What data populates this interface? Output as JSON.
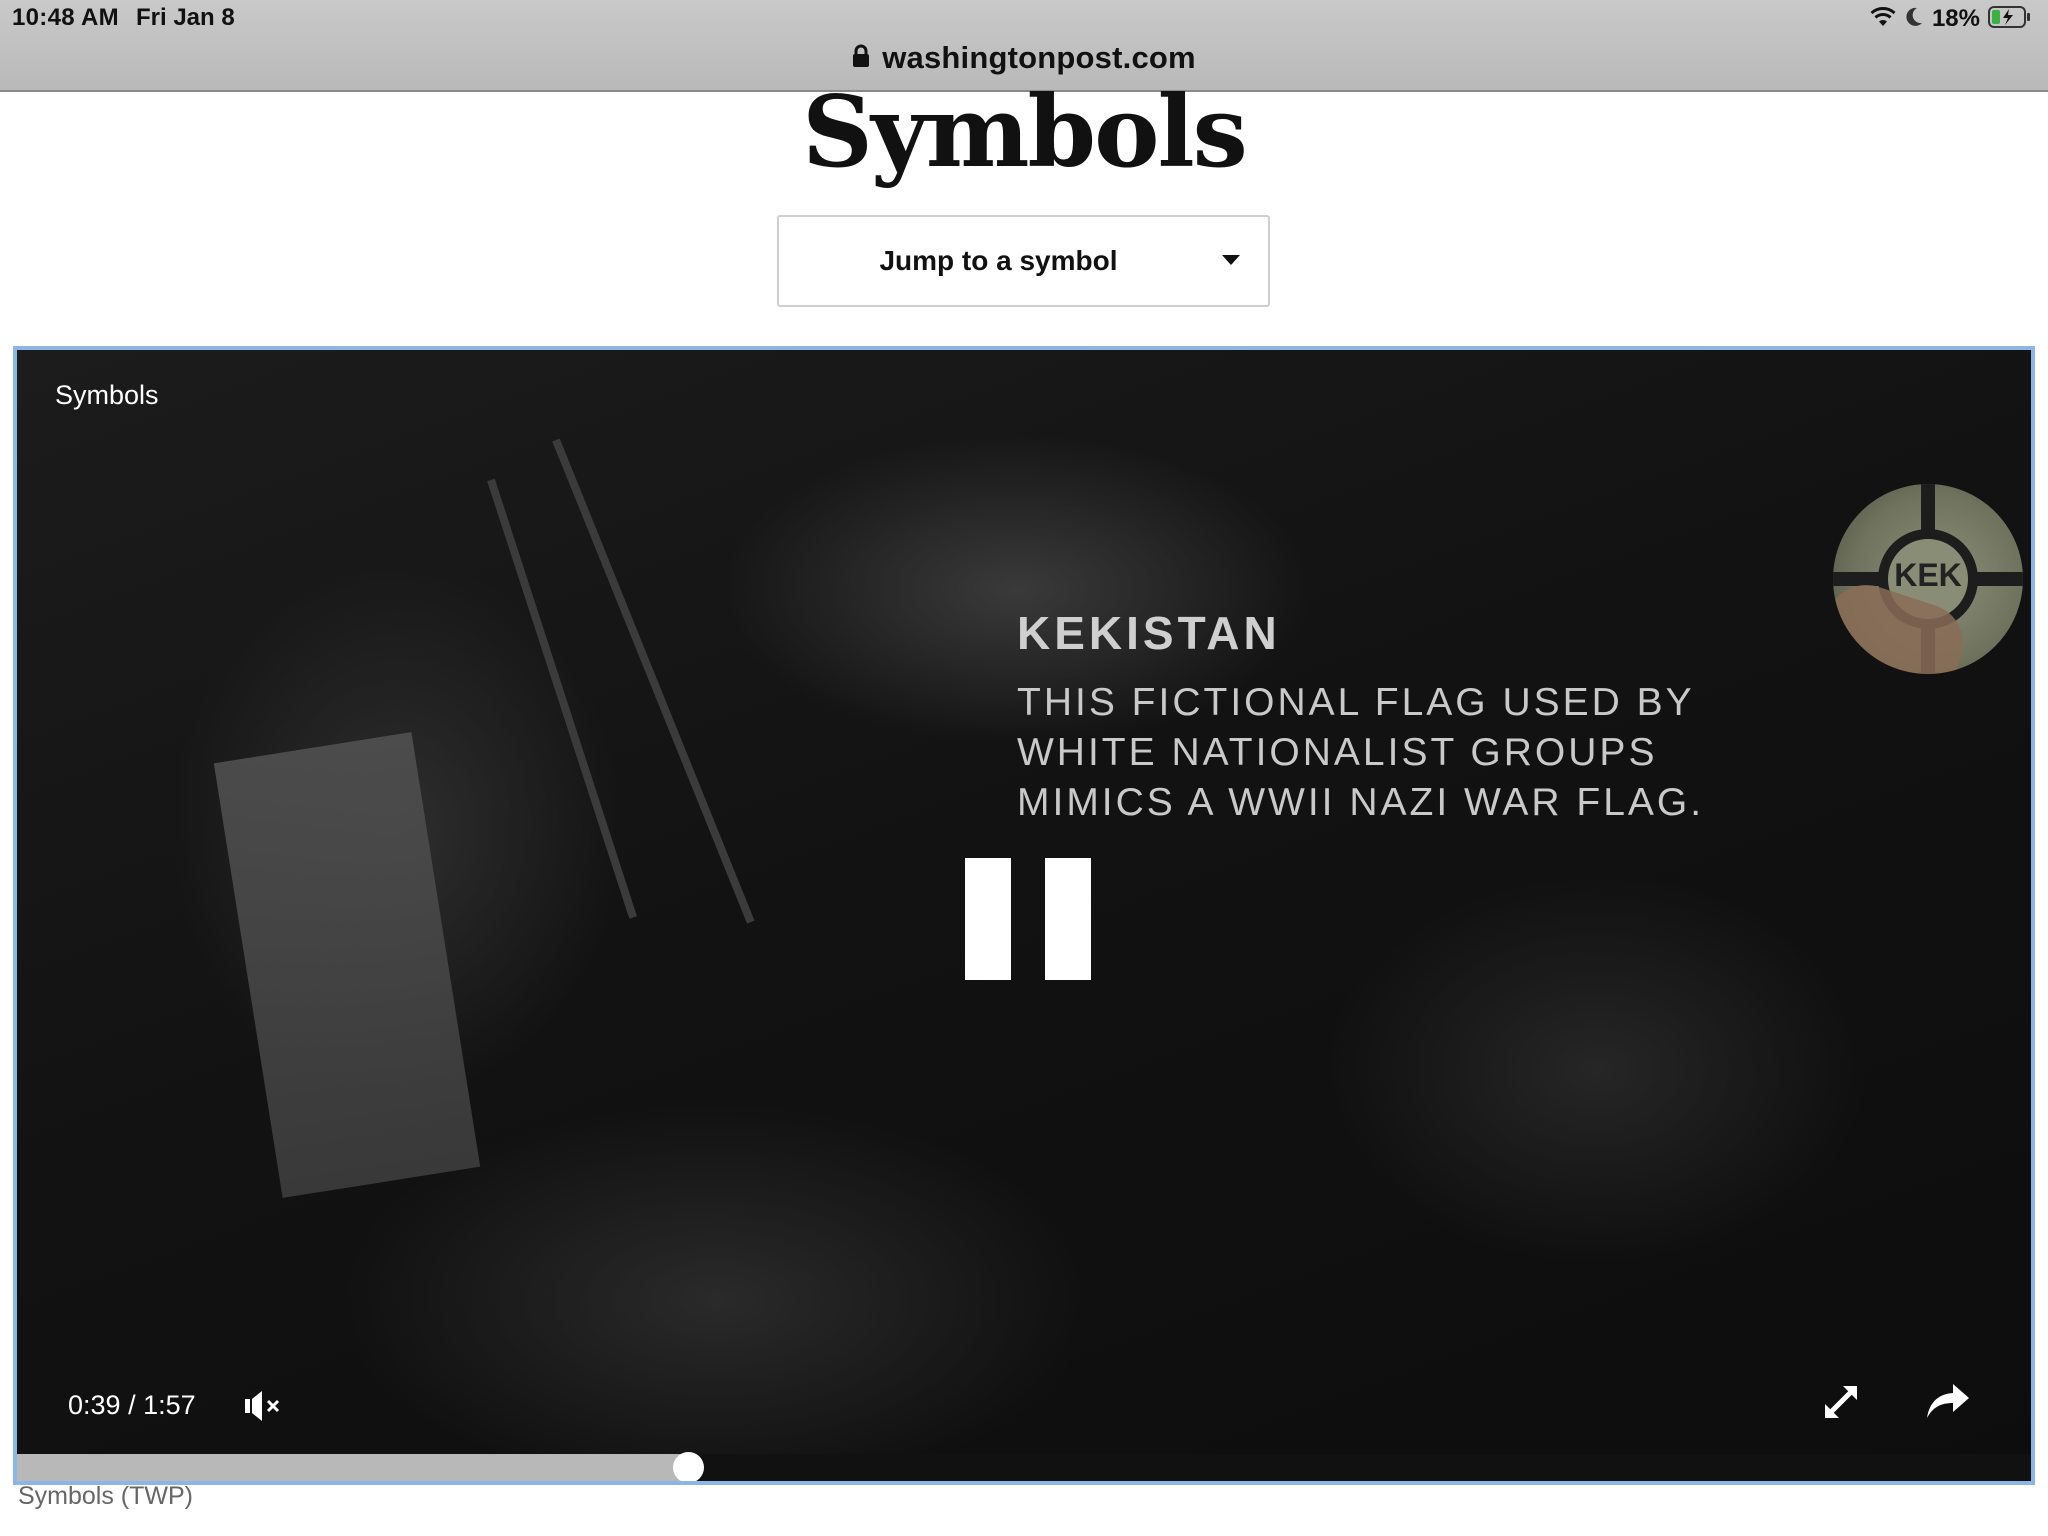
{
  "status_bar": {
    "time": "10:48 AM",
    "date": "Fri Jan 8",
    "battery": "18%",
    "icons": [
      "wifi-icon",
      "moon-icon",
      "battery-charging-icon"
    ]
  },
  "browser": {
    "url": "washingtonpost.com",
    "icons": [
      "lock-icon"
    ]
  },
  "page": {
    "title": "Symbols",
    "jump_select": {
      "label": "Jump to a symbol",
      "icon": "caret-down-icon"
    }
  },
  "video": {
    "title": "Symbols",
    "caption": {
      "heading": "KEKISTAN",
      "lines": [
        "THIS FICTIONAL FLAG USED BY",
        "WHITE NATIONALIST GROUPS",
        "MIMICS A WWII NAZI WAR FLAG."
      ]
    },
    "flag_mark": "KEK",
    "current_time": "0:39",
    "separator": "/",
    "duration": "1:57",
    "progress_fraction": 0.333,
    "controls": [
      "pause-icon",
      "mute-icon",
      "fullscreen-icon",
      "share-icon"
    ],
    "border_color": "#8fb4e6"
  },
  "source_caption": "Symbols (TWP)"
}
